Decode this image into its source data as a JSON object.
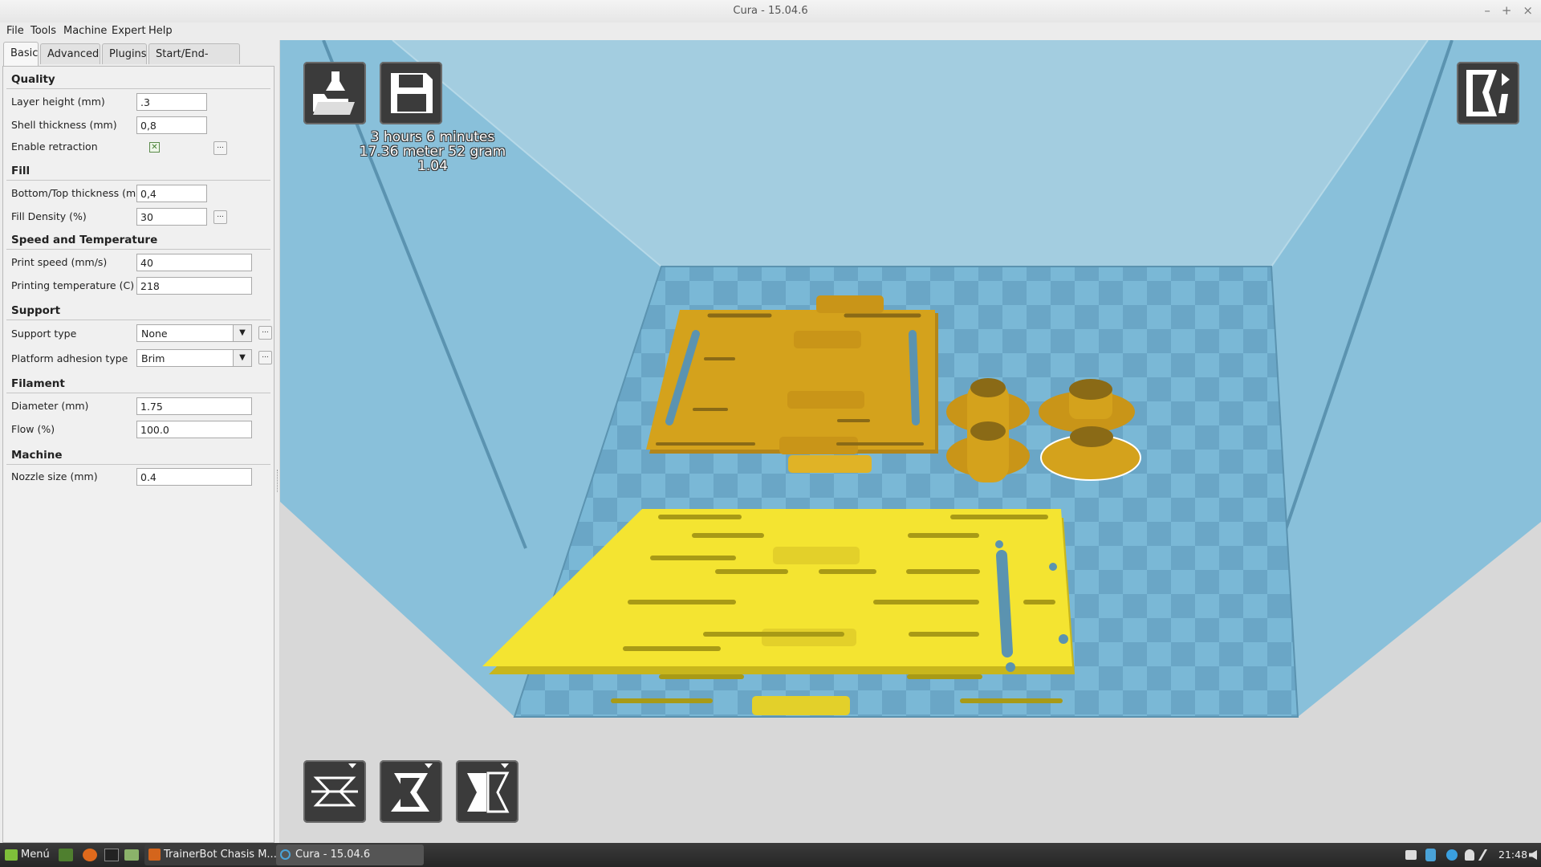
{
  "window": {
    "title": "Cura - 15.04.6"
  },
  "menu": [
    "File",
    "Tools",
    "Machine",
    "Expert",
    "Help"
  ],
  "tabs": [
    "Basic",
    "Advanced",
    "Plugins",
    "Start/End-GCode"
  ],
  "sections": {
    "quality": "Quality",
    "fill": "Fill",
    "speed": "Speed and Temperature",
    "support": "Support",
    "filament": "Filament",
    "machine": "Machine"
  },
  "fields": {
    "layer_height": {
      "label": "Layer height (mm)",
      "value": ".3"
    },
    "shell_thickness": {
      "label": "Shell thickness (mm)",
      "value": "0,8"
    },
    "enable_retraction": {
      "label": "Enable retraction",
      "checked": true
    },
    "bottom_top": {
      "label": "Bottom/Top thickness (mm)",
      "value": "0,4"
    },
    "fill_density": {
      "label": "Fill Density (%)",
      "value": "30"
    },
    "print_speed": {
      "label": "Print speed (mm/s)",
      "value": "40"
    },
    "print_temp": {
      "label": "Printing temperature (C)",
      "value": "218"
    },
    "support_type": {
      "label": "Support type",
      "value": "None"
    },
    "adhesion": {
      "label": "Platform adhesion type",
      "value": "Brim"
    },
    "diameter": {
      "label": "Diameter (mm)",
      "value": "1.75"
    },
    "flow": {
      "label": "Flow (%)",
      "value": "100.0"
    },
    "nozzle": {
      "label": "Nozzle size (mm)",
      "value": "0.4"
    }
  },
  "more_button": "...",
  "print_info": {
    "time": "3 hours 6 minutes",
    "material": "17.36 meter 52 gram",
    "cost": "1.04"
  },
  "taskbar": {
    "menu_label": "Menú",
    "task1": "TrainerBot Chasis M...",
    "task2": "Cura - 15.04.6",
    "clock": "21:48"
  },
  "colors": {
    "platform": "#76b5d3",
    "model_selected": "#f4e431",
    "model": "#d4a21c"
  }
}
